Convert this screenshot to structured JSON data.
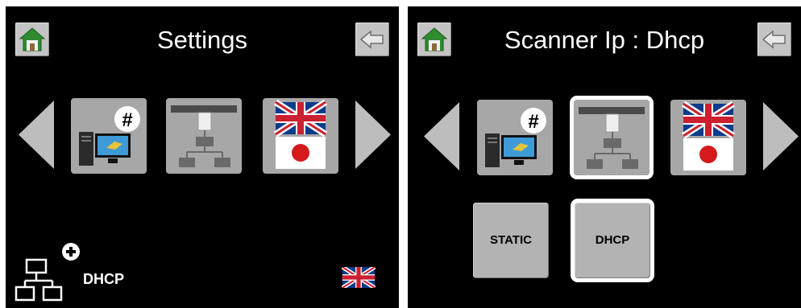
{
  "left_screen": {
    "title": "Settings",
    "status": {
      "mode_label": "DHCP",
      "language_icon": "uk-flag-icon"
    },
    "tiles": [
      {
        "name": "computer-hash-icon",
        "selected": false
      },
      {
        "name": "scanner-network-icon",
        "selected": false
      },
      {
        "name": "language-flags-icon",
        "selected": false
      }
    ]
  },
  "right_screen": {
    "title": "Scanner Ip : Dhcp",
    "tiles": [
      {
        "name": "computer-hash-icon",
        "selected": false
      },
      {
        "name": "scanner-network-icon",
        "selected": true
      },
      {
        "name": "language-flags-icon",
        "selected": false
      }
    ],
    "options": [
      {
        "label": "STATIC",
        "selected": false
      },
      {
        "label": "DHCP",
        "selected": true
      }
    ]
  },
  "colors": {
    "screen_bg": "#000000",
    "tile_bg": "#a7a7a7",
    "arrow": "#bdbdbd",
    "home_roof": "#2e8b2e",
    "selection_outline": "#ffffff",
    "uk_blue": "#0a3b8c",
    "uk_red": "#cc1f2f",
    "japan_red": "#d41a1a"
  }
}
